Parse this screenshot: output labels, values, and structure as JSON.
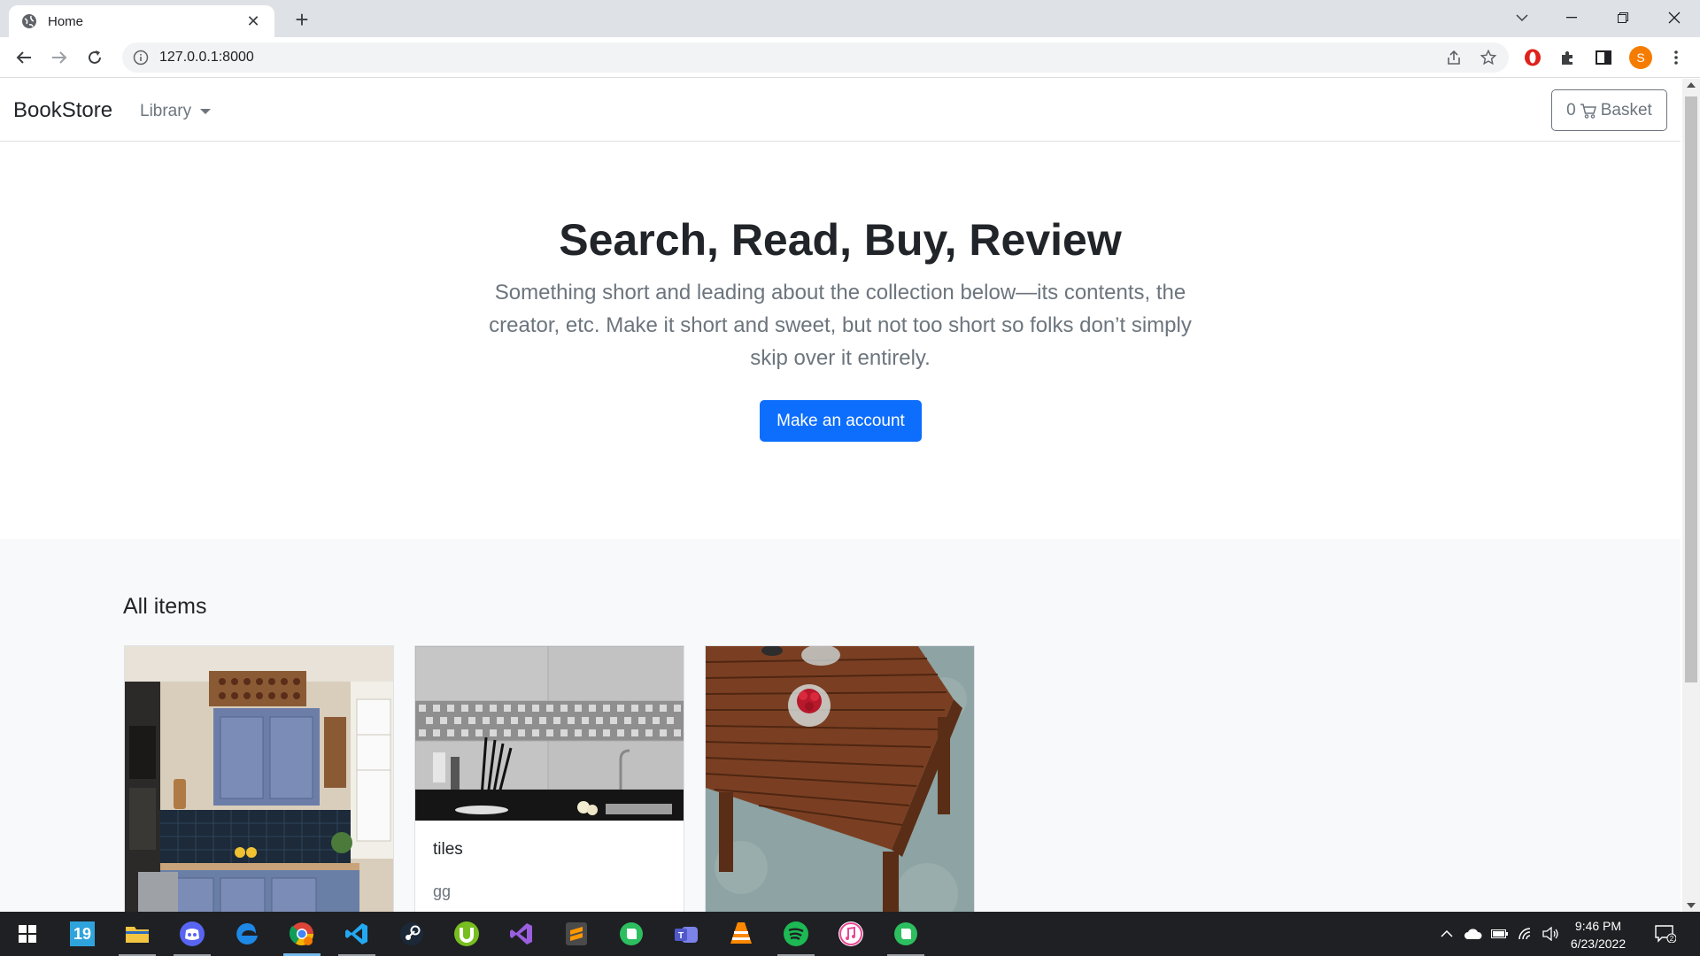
{
  "browser": {
    "tab_title": "Home",
    "url": "127.0.0.1:8000",
    "profile_initial": "S"
  },
  "navbar": {
    "brand": "BookStore",
    "library_label": "Library",
    "basket_count": "0",
    "basket_label": "Basket"
  },
  "hero": {
    "title": "Search, Read, Buy, Review",
    "lead": "Something short and leading about the collection below—its contents, the creator, etc. Make it short and sweet, but not too short so folks don’t simply skip over it entirely.",
    "cta_label": "Make an account"
  },
  "album": {
    "heading": "All items",
    "items": [
      {
        "title": "",
        "text": "",
        "image": "kitchen-photo"
      },
      {
        "title": "tiles",
        "text": "gg",
        "image": "tiles-photo"
      },
      {
        "title": "",
        "text": "",
        "image": "wooden-table-photo"
      }
    ]
  },
  "taskbar": {
    "time": "9:46 PM",
    "date": "6/23/2022",
    "notification_count": "2",
    "calendar_day": "19"
  },
  "colors": {
    "primary": "#0d6efd",
    "taskbar": "#1f2023",
    "tabbar": "#dee1e6"
  }
}
